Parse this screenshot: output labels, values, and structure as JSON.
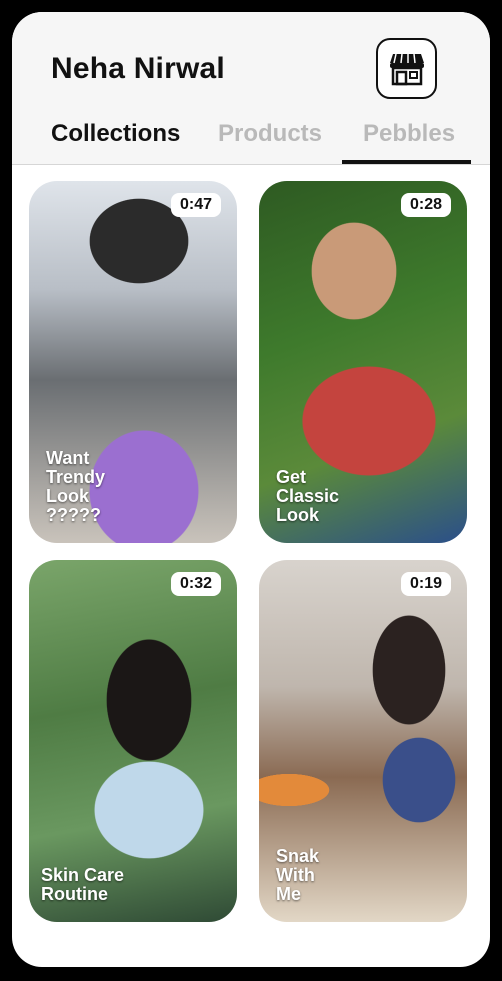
{
  "profile": {
    "name": "Neha Nirwal"
  },
  "header": {
    "shop_icon": "store-icon"
  },
  "tabs": [
    {
      "label": "Collections",
      "active": true
    },
    {
      "label": "Products",
      "active": false
    },
    {
      "label": "Pebbles",
      "active": false
    }
  ],
  "colors": {
    "text": "#111111",
    "inactive_tab": "#b9b9b9",
    "header_bg": "#f6f6f6"
  },
  "videos": [
    {
      "duration": "0:47",
      "caption": "Want\nTrendy\nLook\n?????"
    },
    {
      "duration": "0:28",
      "caption": "Get\nClassic\nLook"
    },
    {
      "duration": "0:32",
      "caption": "Skin Care\nRoutine"
    },
    {
      "duration": "0:19",
      "caption": "Snak\nWith\nMe"
    }
  ]
}
